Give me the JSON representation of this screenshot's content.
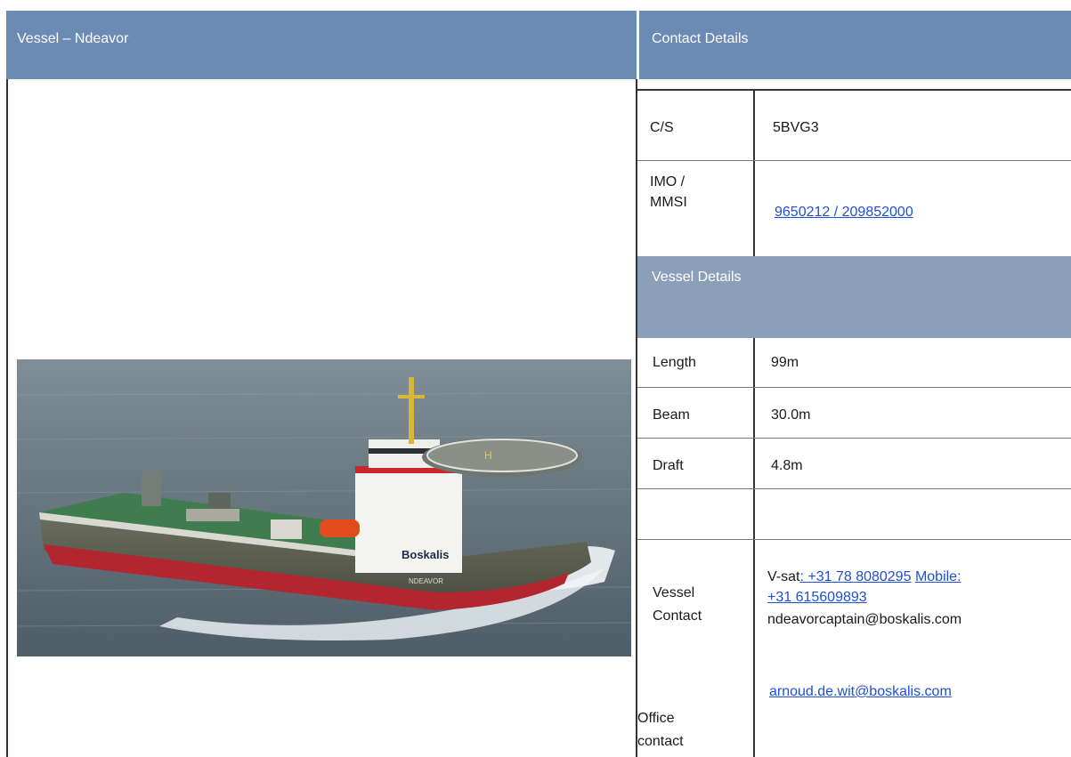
{
  "left_header": "Vessel – Ndeavor",
  "contact_header": "Contact Details",
  "vessel_details_header": "Vessel Details",
  "photo": {
    "hull_name": "NDEAVOR",
    "logo_text": "Boskalis"
  },
  "rows": {
    "cs": {
      "label": "C/S",
      "value": "5BVG3"
    },
    "imo": {
      "label_line1": "IMO /",
      "label_line2": "MMSI",
      "value": "9650212 / 209852000"
    },
    "length": {
      "label": "Length",
      "value": "99m"
    },
    "beam": {
      "label": "Beam",
      "value": "30.0m"
    },
    "draft": {
      "label": "Draft",
      "value": "4.8m"
    }
  },
  "vessel_contact": {
    "label_line1": "Vessel",
    "label_line2": "Contact",
    "vsat_prefix": "V-sat",
    "vsat_link": ": +31 78 8080295",
    "mobile_link_1": "Mobile:",
    "mobile_link_2": "+31 615609893",
    "email": "ndeavorcaptain@boskalis.com"
  },
  "office_contact": {
    "label_line1": "Office",
    "label_line2": "contact",
    "email": "arnoud.de.wit@boskalis.com"
  }
}
